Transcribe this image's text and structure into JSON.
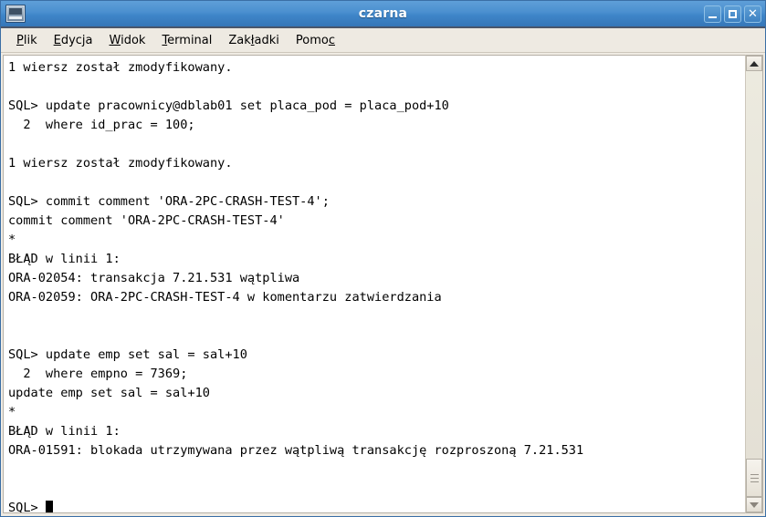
{
  "window": {
    "title": "czarna",
    "icon": "terminal-icon",
    "controls": {
      "minimize_label": "–",
      "maximize_label": "□",
      "close_label": "✕"
    }
  },
  "menubar": {
    "items": [
      {
        "label": "Plik",
        "mnemonic": "P"
      },
      {
        "label": "Edycja",
        "mnemonic": "E"
      },
      {
        "label": "Widok",
        "mnemonic": "W"
      },
      {
        "label": "Terminal",
        "mnemonic": "T"
      },
      {
        "label": "Zakładki",
        "mnemonic": "ł"
      },
      {
        "label": "Pomoc",
        "mnemonic": "c"
      }
    ]
  },
  "terminal": {
    "prompt": "SQL> ",
    "cursor_visible": true,
    "lines": [
      "1 wiersz został zmodyfikowany.",
      "",
      "SQL> update pracownicy@dblab01 set placa_pod = placa_pod+10",
      "  2  where id_prac = 100;",
      "",
      "1 wiersz został zmodyfikowany.",
      "",
      "SQL> commit comment 'ORA-2PC-CRASH-TEST-4';",
      "commit comment 'ORA-2PC-CRASH-TEST-4'",
      "*",
      "BŁĄD w linii 1:",
      "ORA-02054: transakcja 7.21.531 wątpliwa",
      "ORA-02059: ORA-2PC-CRASH-TEST-4 w komentarzu zatwierdzania",
      "",
      "",
      "SQL> update emp set sal = sal+10",
      "  2  where empno = 7369;",
      "update emp set sal = sal+10",
      "*",
      "BŁĄD w linii 1:",
      "ORA-01591: blokada utrzymywana przez wątpliwą transakcję rozproszoną 7.21.531",
      "",
      "",
      "SQL> "
    ]
  },
  "scrollbar": {
    "up_arrow": "triangle-up",
    "down_arrow": "triangle-down",
    "thumb_position": "bottom"
  },
  "colors": {
    "titlebar_blue": "#4a8fcf",
    "menubar_bg": "#eeeae2",
    "terminal_bg": "#ffffff",
    "terminal_fg": "#000000"
  }
}
